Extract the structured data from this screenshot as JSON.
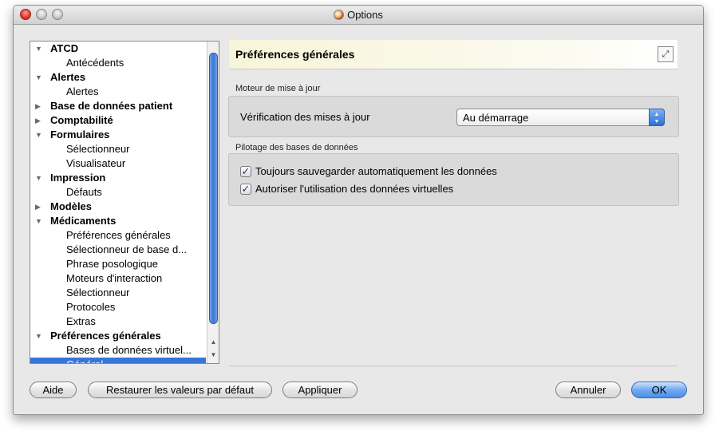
{
  "window": {
    "title": "Options"
  },
  "tree": {
    "rows": [
      {
        "label": "ATCD",
        "kind": "cat",
        "expanded": true
      },
      {
        "label": "Antécédents",
        "kind": "child"
      },
      {
        "label": "Alertes",
        "kind": "cat",
        "expanded": true
      },
      {
        "label": "Alertes",
        "kind": "child"
      },
      {
        "label": "Base de données patient",
        "kind": "cat",
        "expanded": false
      },
      {
        "label": "Comptabilité",
        "kind": "cat",
        "expanded": false
      },
      {
        "label": "Formulaires",
        "kind": "cat",
        "expanded": true
      },
      {
        "label": "Sélectionneur",
        "kind": "child"
      },
      {
        "label": "Visualisateur",
        "kind": "child"
      },
      {
        "label": "Impression",
        "kind": "cat",
        "expanded": true
      },
      {
        "label": "Défauts",
        "kind": "child"
      },
      {
        "label": "Modèles",
        "kind": "cat",
        "expanded": false
      },
      {
        "label": "Médicaments",
        "kind": "cat",
        "expanded": true
      },
      {
        "label": "Préférences générales",
        "kind": "child"
      },
      {
        "label": "Sélectionneur de base d...",
        "kind": "child"
      },
      {
        "label": "Phrase posologique",
        "kind": "child"
      },
      {
        "label": "Moteurs d'interaction",
        "kind": "child"
      },
      {
        "label": "Sélectionneur",
        "kind": "child"
      },
      {
        "label": "Protocoles",
        "kind": "child"
      },
      {
        "label": "Extras",
        "kind": "child"
      },
      {
        "label": "Préférences générales",
        "kind": "cat",
        "expanded": true
      },
      {
        "label": "Bases de données virtuel...",
        "kind": "child"
      },
      {
        "label": "Général",
        "kind": "child",
        "selected": true
      }
    ]
  },
  "panel": {
    "title": "Préférences générales",
    "update_group": {
      "title": "Moteur de mise à jour",
      "label": "Vérification des mises à jour",
      "selected": "Au démarrage"
    },
    "db_group": {
      "title": "Pilotage des bases de données",
      "options": [
        {
          "label": "Toujours sauvegarder automatiquement les données",
          "checked": true
        },
        {
          "label": "Autoriser l'utilisation des données virtuelles",
          "checked": true
        }
      ]
    }
  },
  "buttons": {
    "help": "Aide",
    "restore": "Restaurer les valeurs par défaut",
    "apply": "Appliquer",
    "cancel": "Annuler",
    "ok": "OK"
  },
  "icons": {
    "expand": "expand-arrows-icon",
    "check": "checkmark-icon",
    "expanded_tri": "triangle-down-icon",
    "collapsed_tri": "triangle-right-icon"
  },
  "colors": {
    "selection": "#3875d7",
    "accent_button": "#4b8ee6"
  }
}
